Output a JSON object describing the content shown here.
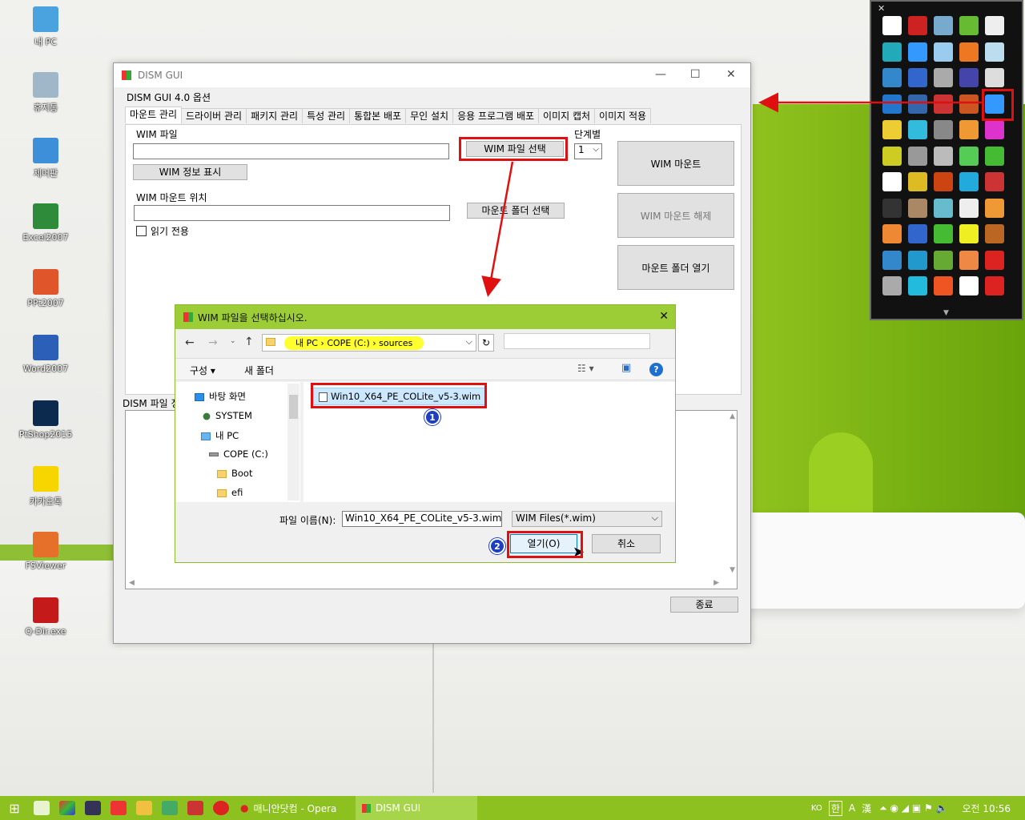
{
  "desktop": {
    "icons": [
      {
        "label": "내 PC",
        "icon": "pc-icon",
        "color": "#4aa3df"
      },
      {
        "label": "휴지통",
        "icon": "recycle-bin-icon",
        "color": "#9fb7c8"
      },
      {
        "label": "제어판",
        "icon": "control-panel-icon",
        "color": "#3d8fd9"
      },
      {
        "label": "Excel2007",
        "icon": "excel-icon",
        "color": "#2e8b3a"
      },
      {
        "label": "PPt2007",
        "icon": "powerpoint-icon",
        "color": "#e0562a"
      },
      {
        "label": "Word2007",
        "icon": "word-icon",
        "color": "#2b5fb8"
      },
      {
        "label": "PtShop2015",
        "icon": "photoshop-icon",
        "color": "#0c2a4e"
      },
      {
        "label": "카카오톡",
        "icon": "kakaotalk-icon",
        "color": "#f7d600"
      },
      {
        "label": "FSViewer",
        "icon": "fsviewer-icon",
        "color": "#e6702a"
      },
      {
        "label": "Q-Dir.exe",
        "icon": "qdir-icon",
        "color": "#c41a1a"
      }
    ]
  },
  "main_window": {
    "title": "DISM GUI",
    "options_label": "DISM GUI 4.0 옵션",
    "tabs": [
      "마운트 관리",
      "드라이버 관리",
      "패키지 관리",
      "특성 관리",
      "통합본 배포",
      "무인 설치",
      "응용 프로그램 배포",
      "이미지 캡처",
      "이미지 적용"
    ],
    "wim_file_label": "WIM 파일",
    "wim_file_value": "",
    "select_wim_button": "WIM 파일 선택",
    "index_label": "단계별",
    "index_value": "1",
    "wim_info_button": "WIM 정보 표시",
    "mount_location_label": "WIM 마운트 위치",
    "mount_location_value": "",
    "select_mount_folder_button": "마운트 폴더 선택",
    "readonly_label": "읽기 전용",
    "mount_button": "WIM 마운트",
    "unmount_button": "WIM 마운트 해제",
    "open_mount_folder_button": "마운트 폴더 열기",
    "dism_output_label": "DISM 파일 정",
    "exit_button": "종료"
  },
  "file_dialog": {
    "title": "WIM 파일을 선택하십시오.",
    "breadcrumb": [
      "내 PC",
      "COPE (C:)",
      "sources"
    ],
    "organize_button": "구성",
    "new_folder_button": "새 폴더",
    "tree": [
      {
        "label": "바탕 화면",
        "icon": "desktop-folder-icon"
      },
      {
        "label": "SYSTEM",
        "icon": "user-icon"
      },
      {
        "label": "내 PC",
        "icon": "pc-icon"
      },
      {
        "label": "COPE (C:)",
        "icon": "drive-icon"
      },
      {
        "label": "Boot",
        "icon": "folder-icon"
      },
      {
        "label": "efi",
        "icon": "folder-icon"
      }
    ],
    "file_item": "Win10_X64_PE_COLite_v5-3.wim",
    "filename_label": "파일 이름(N):",
    "filename_value": "Win10_X64_PE_COLite_v5-3.wim",
    "filter_value": "WIM Files(*.wim)",
    "open_button": "열기(O)",
    "cancel_button": "취소",
    "step1": "1",
    "step2": "2"
  },
  "launcher": {
    "icon_colors": [
      "#fff",
      "#c22",
      "#7ac",
      "#6b3",
      "#eee",
      "#2ab",
      "#39f",
      "#9ce",
      "#e72",
      "#bde",
      "#38c",
      "#36c",
      "#aaa",
      "#44a",
      "#ddd",
      "#27c",
      "#36a",
      "#c33",
      "#c52",
      "#39f",
      "#ec3",
      "#3bd",
      "#888",
      "#e93",
      "#d3c",
      "#cc2",
      "#999",
      "#bbb",
      "#5c5",
      "#4b3",
      "#fff",
      "#db2",
      "#c41",
      "#2ad",
      "#c33",
      "#333",
      "#a86",
      "#6bc",
      "#eee",
      "#e93",
      "#e83",
      "#36c",
      "#4b3",
      "#ee2",
      "#b62",
      "#38c",
      "#29c",
      "#6a3",
      "#e84",
      "#d22",
      "#aaa",
      "#2bd",
      "#e52",
      "#fff",
      "#d22"
    ]
  },
  "taskbar": {
    "tasks": [
      "매니안닷컴 - Opera",
      "DISM GUI"
    ],
    "ime": "KO",
    "lang": "한",
    "time": "오전 10:56"
  }
}
